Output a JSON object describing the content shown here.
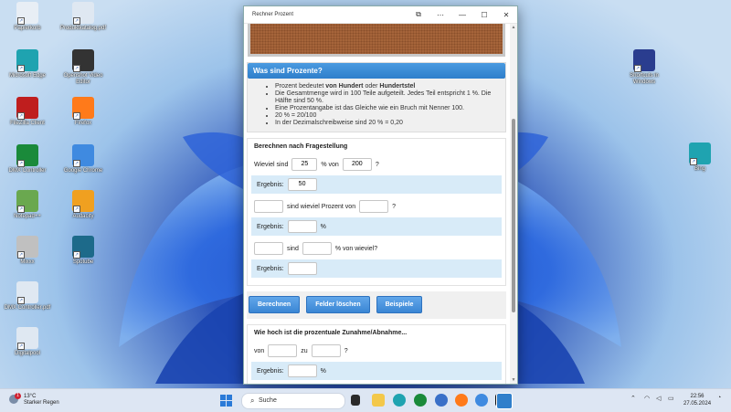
{
  "desktop": {
    "icons_left": [
      {
        "label": "Papierkorb",
        "name": "recycle-bin-icon",
        "color": "#e8eef5"
      },
      {
        "label": "Produktkatalog.pdf",
        "name": "pdf-file-icon",
        "color": "#dfe8f2"
      },
      {
        "label": "Microsoft Edge",
        "name": "edge-icon",
        "color": "#1fa3b0"
      },
      {
        "label": "Openshot Video Editor",
        "name": "openshot-icon",
        "color": "#333333"
      },
      {
        "label": "FileZilla Client",
        "name": "filezilla-icon",
        "color": "#bf1e1e"
      },
      {
        "label": "Firefox",
        "name": "firefox-icon",
        "color": "#ff7a1a"
      },
      {
        "label": "DMX Controller",
        "name": "dmx-controller-icon",
        "color": "#1a8a3a"
      },
      {
        "label": "Google Chrome",
        "name": "chrome-icon",
        "color": "#3f8ae0"
      },
      {
        "label": "Notepad++",
        "name": "notepadpp-icon",
        "color": "#6aa84f"
      },
      {
        "label": "Audacity",
        "name": "audacity-icon",
        "color": "#f0a020"
      },
      {
        "label": "Mixxx",
        "name": "mixxx-icon",
        "color": "#c0c0c0"
      },
      {
        "label": "Spotube",
        "name": "spotube-icon",
        "color": "#1d6a8a"
      },
      {
        "label": "DMX Controller.pdf",
        "name": "pdf-file-icon",
        "color": "#dfe8f2"
      },
      {
        "label": "Digitalpool",
        "name": "folder-file-icon",
        "color": "#dfe8f2"
      }
    ],
    "icons_right": [
      {
        "label": "Shortcuts in Windows",
        "name": "shortcuts-icon",
        "color": "#2a3d8f"
      },
      {
        "label": "Bing",
        "name": "bing-icon",
        "color": "#1fa3b0"
      }
    ]
  },
  "window": {
    "title": "Rechner Prozent",
    "controls": {
      "pin": "⧉",
      "more": "⋯",
      "minimize": "—",
      "maximize": "☐",
      "close": "✕"
    },
    "info": {
      "heading": "Was sind Prozente?",
      "b1_pre": "Prozent bedeutet ",
      "b1_bold1": "von Hundert",
      "b1_mid": " oder ",
      "b1_bold2": "Hundertstel",
      "b2": "Die Gesamtmenge wird in 100 Teile aufgeteilt. Jedes Teil entspricht 1 %. Die Hälfte sind 50 %.",
      "b3": "Eine Prozentangabe ist das Gleiche wie ein Bruch mit Nenner 100.",
      "b4": "20 % = 20/100",
      "b5": "In der Dezimalschreibweise sind 20 % = 0,20"
    },
    "calc": {
      "heading": "Berechnen nach Fragestellung",
      "q1_pre": "Wieviel sind",
      "q1_v1": "25",
      "q1_mid": "% von",
      "q1_v2": "200",
      "q1_post": "?",
      "result_label": "Ergebnis:",
      "r1": "50",
      "q2_mid": "sind wieviel Prozent von",
      "q2_post": "?",
      "r2_unit": "%",
      "q3_mid": "sind",
      "q3_post": "% von wieviel?",
      "btn_calc": "Berechnen",
      "btn_clear": "Felder löschen",
      "btn_examples": "Beispiele"
    },
    "change": {
      "heading": "Wie hoch ist die prozentuale Zunahme/Abnahme...",
      "from": "von",
      "to": "zu",
      "post": "?",
      "result_label": "Ergebnis:",
      "unit": "%"
    }
  },
  "taskbar": {
    "weather_temp": "13°C",
    "weather_text": "Starker Regen",
    "weather_badge": "1",
    "search_placeholder": "Suche",
    "clock_time": "22:56",
    "clock_date": "27.05.2024",
    "tray_icons": [
      "chevron-up-icon",
      "wifi-icon",
      "speaker-icon",
      "battery-icon",
      "bell-icon"
    ]
  },
  "colors": {
    "accent": "#3a86d4",
    "result_bg": "#d8ebf8",
    "taskbar": "#dde6f3"
  }
}
